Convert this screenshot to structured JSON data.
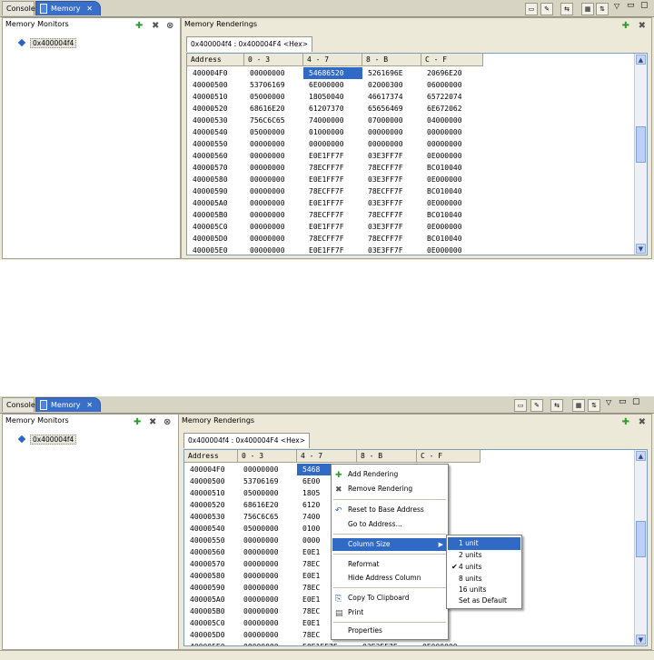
{
  "top": {
    "tabs": [
      {
        "label": "Console"
      },
      {
        "label": "Memory"
      }
    ],
    "monitors_title": "Memory Monitors",
    "renderings_title": "Memory Renderings",
    "monitor_item": "0x400004f4",
    "rendering_tab": "0x400004f4 : 0x400004F4 <Hex>",
    "headers": [
      "Address",
      "0 - 3",
      "4 - 7",
      "8 - B",
      "C - F"
    ],
    "rows": [
      [
        "400004F0",
        "00000000",
        "54686520",
        "5261696E",
        "20696E20"
      ],
      [
        "40000500",
        "53706169",
        "6E000000",
        "02000300",
        "06000000"
      ],
      [
        "40000510",
        "05000000",
        "18050040",
        "46617374",
        "65722074"
      ],
      [
        "40000520",
        "68616E20",
        "61207370",
        "65656469",
        "6E672062"
      ],
      [
        "40000530",
        "756C6C65",
        "74000000",
        "07000000",
        "04000000"
      ],
      [
        "40000540",
        "05000000",
        "01000000",
        "00000000",
        "00000000"
      ],
      [
        "40000550",
        "00000000",
        "00000000",
        "00000000",
        "00000000"
      ],
      [
        "40000560",
        "00000000",
        "E0E1FF7F",
        "03E3FF7F",
        "0E000000"
      ],
      [
        "40000570",
        "00000000",
        "78ECFF7F",
        "78ECFF7F",
        "BC010040"
      ],
      [
        "40000580",
        "00000000",
        "E0E1FF7F",
        "03E3FF7F",
        "0E000000"
      ],
      [
        "40000590",
        "00000000",
        "78ECFF7F",
        "78ECFF7F",
        "BC010040"
      ],
      [
        "400005A0",
        "00000000",
        "E0E1FF7F",
        "03E3FF7F",
        "0E000000"
      ],
      [
        "400005B0",
        "00000000",
        "78ECFF7F",
        "78ECFF7F",
        "BC010040"
      ],
      [
        "400005C0",
        "00000000",
        "E0E1FF7F",
        "03E3FF7F",
        "0E000000"
      ],
      [
        "400005D0",
        "00000000",
        "78ECFF7F",
        "78ECFF7F",
        "BC010040"
      ],
      [
        "400005E0",
        "00000000",
        "E0E1FF7F",
        "03E3FF7F",
        "0E000000"
      ]
    ]
  },
  "bottom": {
    "tabs": [
      {
        "label": "Console"
      },
      {
        "label": "Memory"
      }
    ],
    "monitors_title": "Memory Monitors",
    "renderings_title": "Memory Renderings",
    "monitor_item": "0x400004f4",
    "rendering_tab": "0x400004f4 : 0x400004F4 <Hex>",
    "headers": [
      "Address",
      "0 - 3",
      "4 - 7",
      "8 - B",
      "C - F"
    ],
    "rows": [
      [
        "400004F0",
        "00000000",
        "5468",
        "",
        "6E20"
      ],
      [
        "40000500",
        "53706169",
        "6E00",
        "",
        "0000"
      ],
      [
        "40000510",
        "05000000",
        "1805",
        "",
        "2074"
      ],
      [
        "40000520",
        "68616E20",
        "6120",
        "",
        "2062"
      ],
      [
        "40000530",
        "756C6C65",
        "7400",
        "",
        "0000"
      ],
      [
        "40000540",
        "05000000",
        "0100",
        "",
        "0000"
      ],
      [
        "40000550",
        "00000000",
        "0000",
        "",
        ""
      ],
      [
        "40000560",
        "00000000",
        "E0E1",
        "",
        ""
      ],
      [
        "40000570",
        "00000000",
        "78EC",
        "",
        ""
      ],
      [
        "40000580",
        "00000000",
        "E0E1",
        "",
        ""
      ],
      [
        "40000590",
        "00000000",
        "78EC",
        "",
        ""
      ],
      [
        "400005A0",
        "00000000",
        "E0E1",
        "",
        "0000"
      ],
      [
        "400005B0",
        "00000000",
        "78EC",
        "",
        "0040"
      ],
      [
        "400005C0",
        "00000000",
        "E0E1",
        "",
        "0000"
      ],
      [
        "400005D0",
        "00000000",
        "78EC",
        "",
        "0040"
      ],
      [
        "400005E0",
        "00000000",
        "E0E1FF7F",
        "03E3FF7F",
        "0E000000"
      ]
    ],
    "context_menu": [
      {
        "label": "Add Rendering",
        "icon": "add-icon"
      },
      {
        "label": "Remove Rendering",
        "icon": "remove-icon"
      },
      {
        "label": "Reset to Base Address",
        "icon": "reset-icon"
      },
      {
        "label": "Go to Address..."
      },
      {
        "label": "Column Size",
        "highlighted": true,
        "submenu": true
      },
      {
        "label": "Reformat"
      },
      {
        "label": "Hide Address Column"
      },
      {
        "label": "Copy To Clipboard",
        "icon": "copy-icon"
      },
      {
        "label": "Print",
        "icon": "print-icon"
      },
      {
        "label": "Properties"
      }
    ],
    "submenu": [
      {
        "label": "1 unit",
        "highlighted": true
      },
      {
        "label": "2 units"
      },
      {
        "label": "4 units",
        "checked": true
      },
      {
        "label": "8 units"
      },
      {
        "label": "16 units"
      },
      {
        "label": "Set as Default"
      }
    ]
  },
  "colors": {
    "selection": "#316ac5",
    "tab_active": "#3a6fc9",
    "add_green": "#2e9b2e"
  }
}
